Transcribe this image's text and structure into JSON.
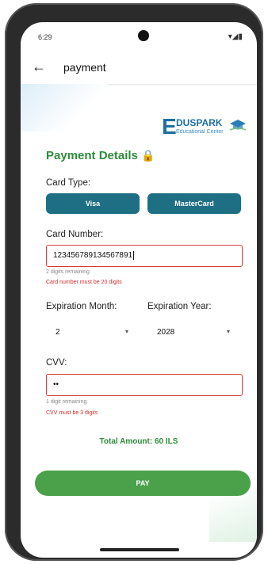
{
  "status": {
    "time": "6:29",
    "icons": "▾◢▮"
  },
  "appbar": {
    "back_icon": "←",
    "title": "payment"
  },
  "logo": {
    "letter": "E",
    "brand": "DUSPARK",
    "subtitle": "Educational Center",
    "mark_text": "EDUSPARK"
  },
  "heading": {
    "title": "Payment Details",
    "lock_icon": "🔒"
  },
  "card_type": {
    "label": "Card Type:",
    "visa": "Visa",
    "mastercard": "MasterCard"
  },
  "card_number": {
    "label": "Card Number:",
    "value": "1234567891345678 91",
    "value_display": "123456789134567891",
    "hint": "2 digits remaining",
    "error": "Card number must be 20 digits"
  },
  "expiration": {
    "month_label": "Expiration Month:",
    "year_label": "Expiration Year:",
    "month_value": "2",
    "year_value": "2028",
    "arrow": "▾"
  },
  "cvv": {
    "label": "CVV:",
    "value": "••",
    "hint": "1 digit remaining",
    "error": "CVV must be 3 digits"
  },
  "total": {
    "text": "Total Amount: 60 ILS"
  },
  "pay": {
    "label": "PAY"
  },
  "colors": {
    "accent_green": "#2e8b3a",
    "button_teal": "#1f6f84",
    "pay_green": "#4aa14a",
    "error_red": "#d62b2b"
  }
}
